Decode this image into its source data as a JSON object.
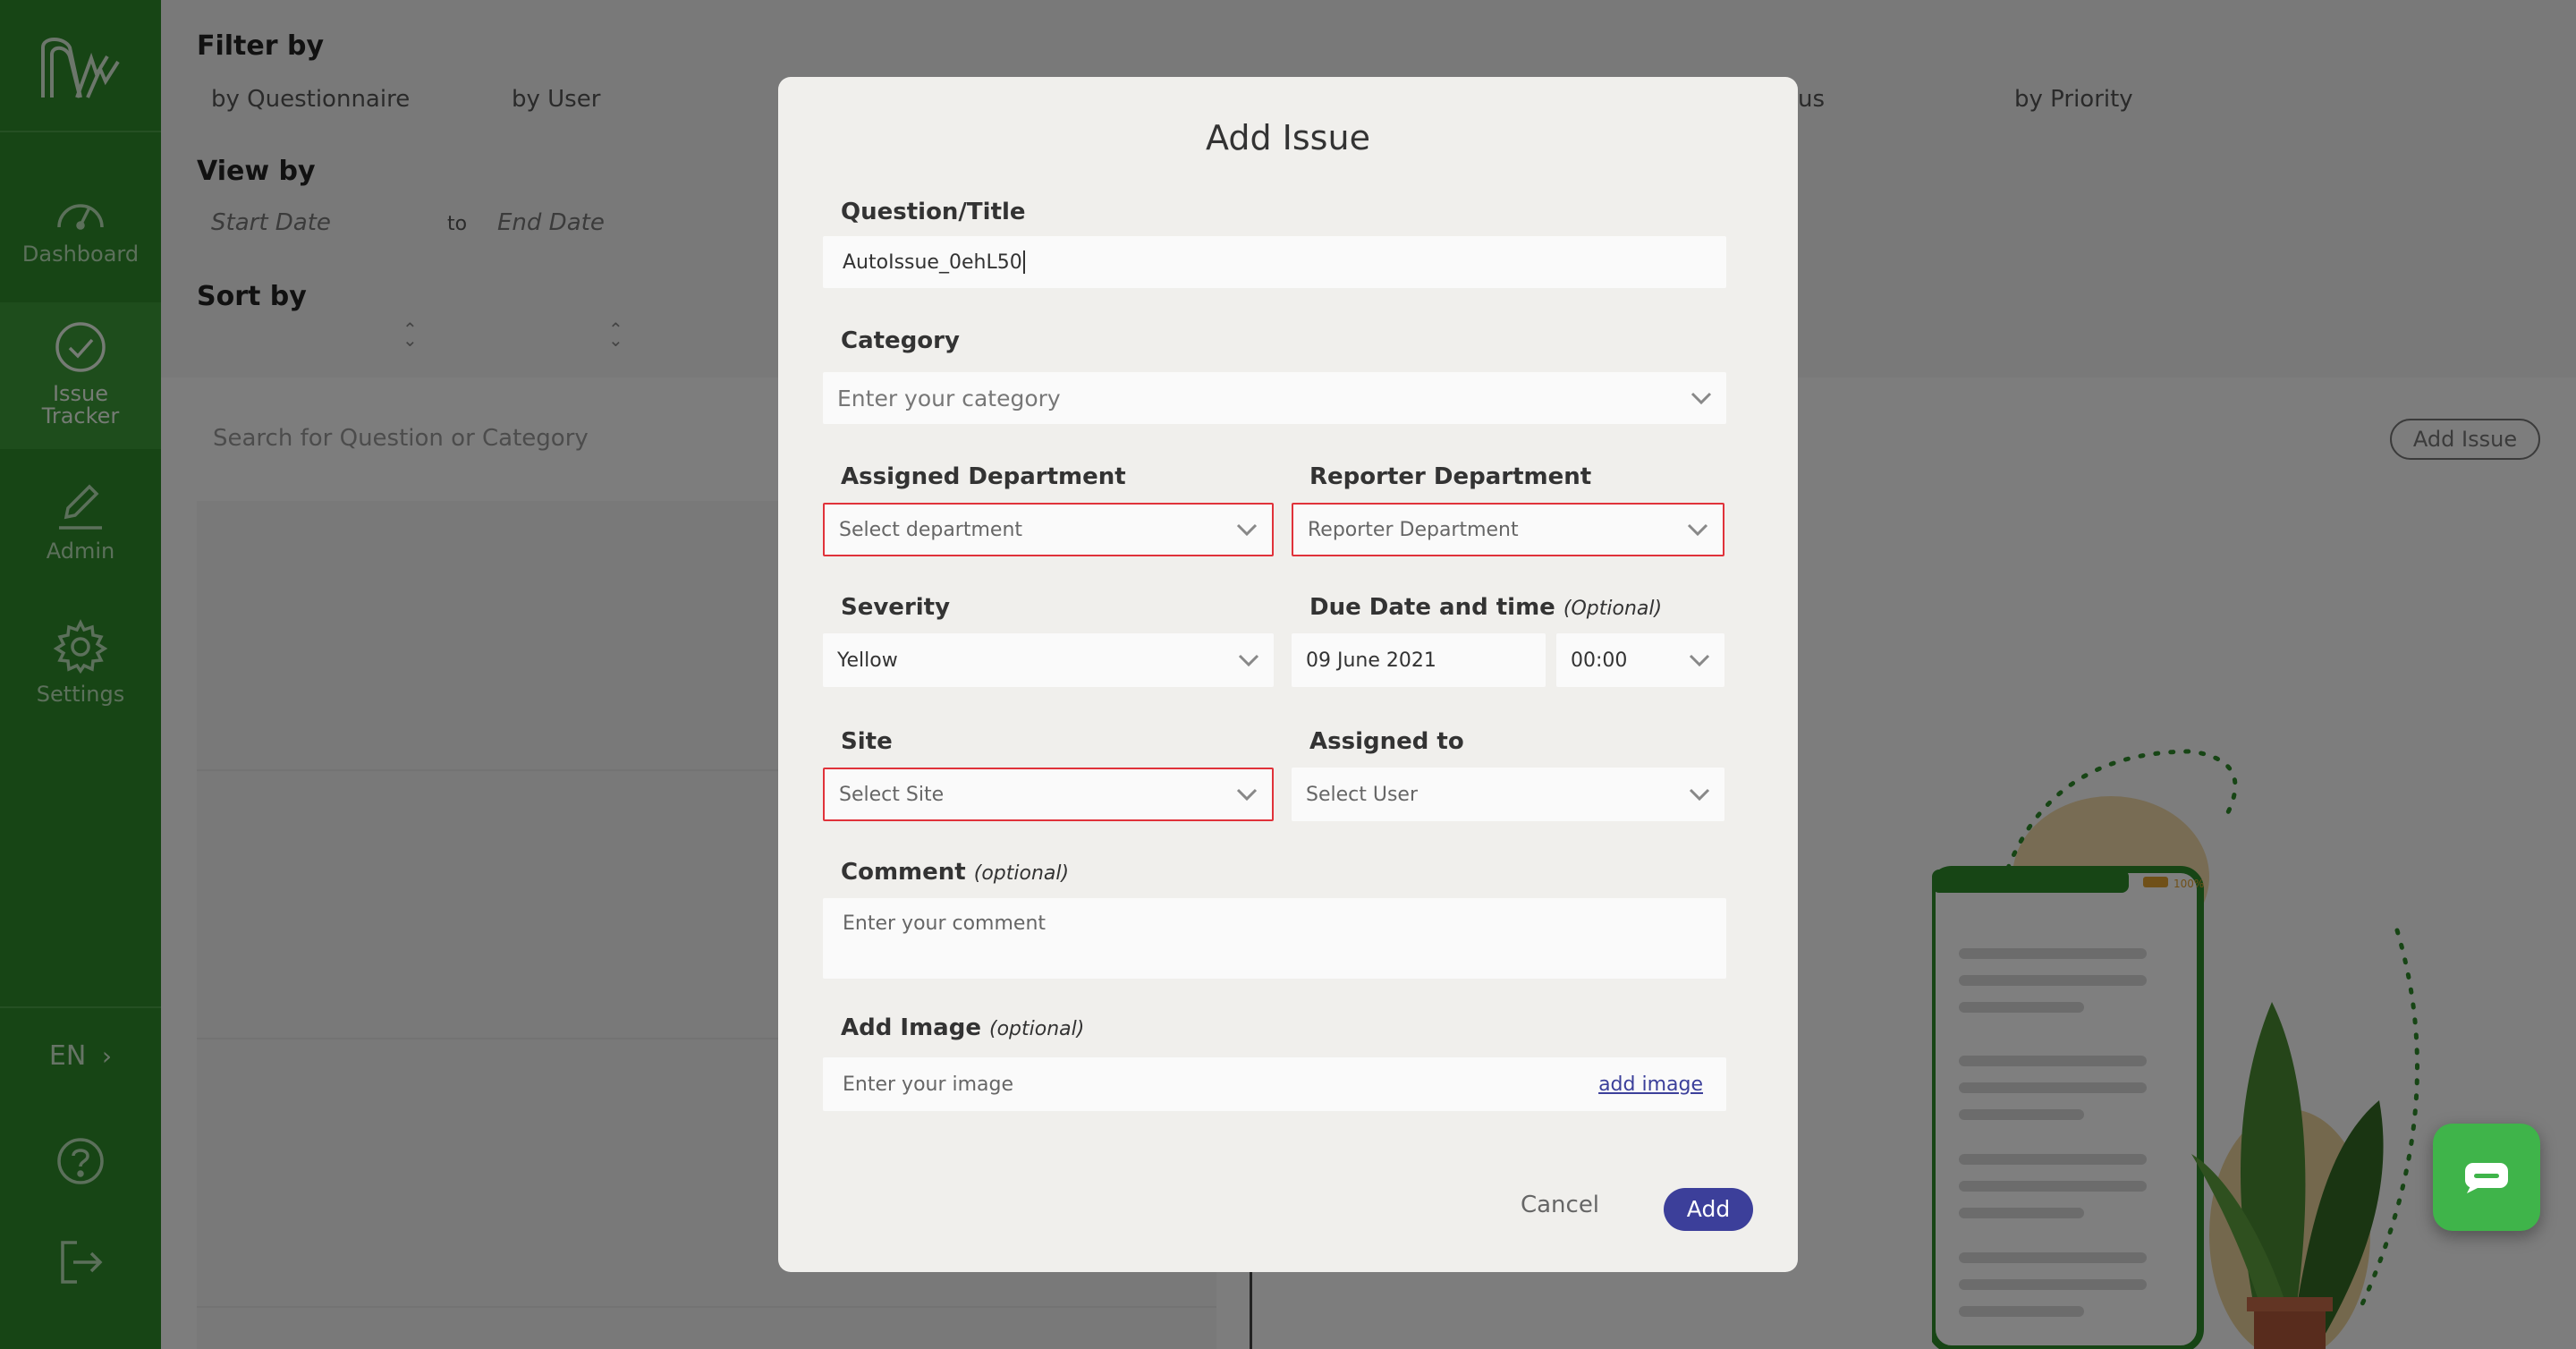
{
  "sidebar": {
    "items": [
      {
        "label": "Dashboard",
        "icon": "dashboard-gauge-icon"
      },
      {
        "label": "Issue\nTracker",
        "icon": "check-circle-icon"
      },
      {
        "label": "Admin",
        "icon": "pencil-icon"
      },
      {
        "label": "Settings",
        "icon": "gear-icon"
      }
    ],
    "language": "EN",
    "help_icon": "help-icon",
    "logout_icon": "logout-icon"
  },
  "filters": {
    "filter_by_heading": "Filter by",
    "by_questionnaire": "by Questionnaire",
    "by_user": "by User",
    "by_status_partial": "us",
    "by_priority": "by Priority",
    "view_by_heading": "View by",
    "start_date_placeholder": "Start Date",
    "to_label": "to",
    "end_date_placeholder": "End Date",
    "sort_by_heading": "Sort by"
  },
  "search": {
    "placeholder": "Search for Question or Category"
  },
  "page_actions": {
    "add_issue_label": "Add Issue"
  },
  "modal": {
    "title": "Add Issue",
    "question_title": {
      "label": "Question/Title",
      "value": "AutoIssue_0ehL50"
    },
    "category": {
      "label": "Category",
      "placeholder": "Enter your category"
    },
    "assigned_department": {
      "label": "Assigned Department",
      "placeholder": "Select department"
    },
    "reporter_department": {
      "label": "Reporter Department",
      "placeholder": "Reporter Department"
    },
    "severity": {
      "label": "Severity",
      "value": "Yellow"
    },
    "due_date": {
      "label": "Due Date and time",
      "optional": "(Optional)",
      "date_value": "09 June 2021",
      "time_value": "00:00"
    },
    "site": {
      "label": "Site",
      "placeholder": "Select Site"
    },
    "assigned_to": {
      "label": "Assigned to",
      "placeholder": "Select User"
    },
    "comment": {
      "label": "Comment",
      "optional": "(optional)",
      "placeholder": "Enter your comment"
    },
    "add_image": {
      "label": "Add Image",
      "optional": "(optional)",
      "placeholder": "Enter your image",
      "link_label": "add image"
    },
    "cancel_label": "Cancel",
    "add_label": "Add"
  },
  "illustration": {
    "battery_label": "100%"
  },
  "colors": {
    "sidebar_green": "#2e8a2b",
    "primary_button": "#3c3f9a",
    "error_border": "#e0323a",
    "chat_green": "#3fb44a"
  }
}
